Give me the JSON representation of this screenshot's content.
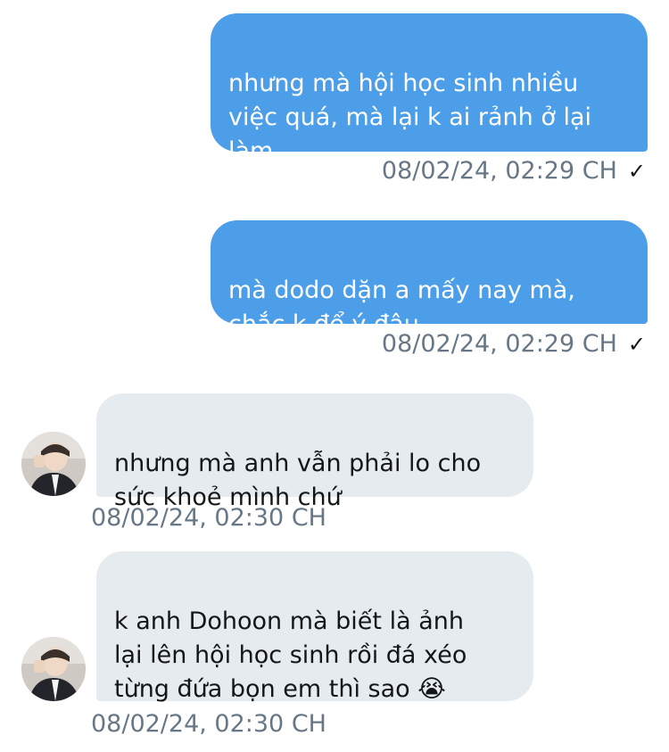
{
  "messages": [
    {
      "direction": "sent",
      "text": "nhưng mà hội học sinh nhiều\nviệc quá, mà lại k ai rảnh ở lại\nlàm",
      "time": "08/02/24, 02:29 CH",
      "status_icon": "check-icon"
    },
    {
      "direction": "sent",
      "text": "mà dodo dặn a mấy nay mà,\nchắc k để ý đâu",
      "time": "08/02/24, 02:29 CH",
      "status_icon": "check-icon"
    },
    {
      "direction": "received",
      "text": "nhưng mà anh vẫn phải lo cho\nsức khoẻ mình chứ",
      "time": "08/02/24, 02:30 CH"
    },
    {
      "direction": "received",
      "text": "k anh Dohoon mà biết là ảnh\nlại lên hội học sinh rồi đá xéo\ntừng đứa bọn em thì sao 😭",
      "time": "08/02/24, 02:30 CH"
    }
  ],
  "colors": {
    "sent_bubble": "#4d9ee8",
    "received_bubble": "#e6ebf0",
    "timestamp": "#687786"
  }
}
